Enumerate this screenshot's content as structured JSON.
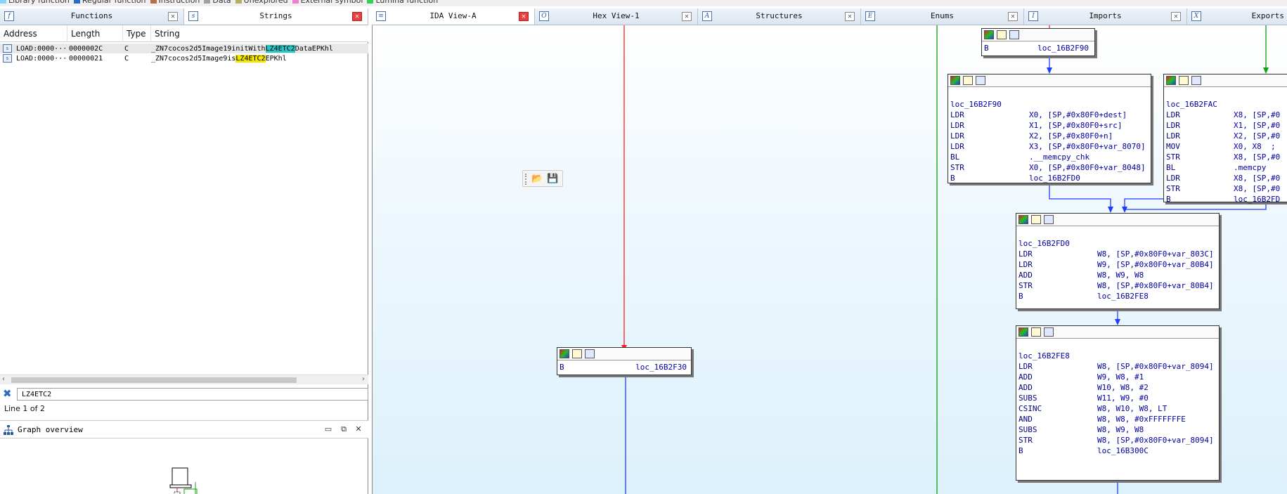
{
  "legend": {
    "items": [
      {
        "label": "Library function",
        "color": "#7fd6ff"
      },
      {
        "label": "Regular function",
        "color": "#1f6fd0"
      },
      {
        "label": "Instruction",
        "color": "#b86e4a"
      },
      {
        "label": "Data",
        "color": "#a0a0a0"
      },
      {
        "label": "Unexplored",
        "color": "#b0b060"
      },
      {
        "label": "External symbol",
        "color": "#f080d0"
      },
      {
        "label": "Lumina function",
        "color": "#30d050"
      }
    ]
  },
  "left_tabs": [
    {
      "label": "Functions",
      "icon": "function-icon",
      "glyph": "f",
      "active": false
    },
    {
      "label": "Strings",
      "icon": "strings-icon",
      "glyph": "s",
      "active": true
    }
  ],
  "main_tabs": [
    {
      "label": "IDA View-A",
      "icon": "ida-view-icon",
      "glyph": "≡",
      "active": true
    },
    {
      "label": "Hex View-1",
      "icon": "hex-view-icon",
      "glyph": "O",
      "active": false
    },
    {
      "label": "Structures",
      "icon": "structures-icon",
      "glyph": "A",
      "active": false
    },
    {
      "label": "Enums",
      "icon": "enums-icon",
      "glyph": "E",
      "active": false
    },
    {
      "label": "Imports",
      "icon": "imports-icon",
      "glyph": "I",
      "active": false
    },
    {
      "label": "Exports",
      "icon": "exports-icon",
      "glyph": "X",
      "active": false
    }
  ],
  "strings": {
    "columns": [
      "Address",
      "Length",
      "Type",
      "String"
    ],
    "rows": [
      {
        "address": "LOAD:0000···",
        "length": "0000002C",
        "type": "C",
        "pre": "_ZN7cocos2d5Image19initWith",
        "match": "LZ4ETC2",
        "post": "DataEPKhl",
        "hl": "cyan"
      },
      {
        "address": "LOAD:0000···",
        "length": "00000021",
        "type": "C",
        "pre": "_ZN7cocos2d5Image9is",
        "match": "LZ4ETC2",
        "post": "EPKhl",
        "hl": "yellow"
      }
    ],
    "search_value": "LZ4ETC2",
    "status": "Line 1 of 2"
  },
  "graph_overview": {
    "title": "Graph overview"
  },
  "graph": {
    "nodes": {
      "top_b": {
        "mnemonic": "B",
        "target": "loc_16B2F90"
      },
      "f90": {
        "label": "loc_16B2F90",
        "lines": [
          {
            "m": "LDR",
            "o": "X0, [SP,#0x80F0+dest]"
          },
          {
            "m": "LDR",
            "o": "X1, [SP,#0x80F0+src]"
          },
          {
            "m": "LDR",
            "o": "X2, [SP,#0x80F0+n]"
          },
          {
            "m": "LDR",
            "o": "X3, [SP,#0x80F0+var_8070]"
          },
          {
            "m": "BL",
            "o": ".__memcpy_chk"
          },
          {
            "m": "STR",
            "o": "X0, [SP,#0x80F0+var_8048]"
          },
          {
            "m": "B",
            "o": "loc_16B2FD0"
          }
        ]
      },
      "fac": {
        "label": "loc_16B2FAC",
        "lines": [
          {
            "m": "LDR",
            "o": "X8, [SP,#0"
          },
          {
            "m": "LDR",
            "o": "X1, [SP,#0"
          },
          {
            "m": "LDR",
            "o": "X2, [SP,#0"
          },
          {
            "m": "MOV",
            "o": "X0, X8  ;"
          },
          {
            "m": "STR",
            "o": "X8, [SP,#0"
          },
          {
            "m": "BL",
            "o": ".memcpy"
          },
          {
            "m": "LDR",
            "o": "X8, [SP,#0"
          },
          {
            "m": "STR",
            "o": "X8, [SP,#0"
          },
          {
            "m": "B",
            "o": "loc_16B2FD"
          }
        ]
      },
      "fd0": {
        "label": "loc_16B2FD0",
        "lines": [
          {
            "m": "LDR",
            "o": "W8, [SP,#0x80F0+var_803C]"
          },
          {
            "m": "LDR",
            "o": "W9, [SP,#0x80F0+var_80B4]"
          },
          {
            "m": "ADD",
            "o": "W8, W9, W8"
          },
          {
            "m": "STR",
            "o": "W8, [SP,#0x80F0+var_80B4]"
          },
          {
            "m": "B",
            "o": "loc_16B2FE8"
          }
        ]
      },
      "fe8": {
        "label": "loc_16B2FE8",
        "lines": [
          {
            "m": "LDR",
            "o": "W8, [SP,#0x80F0+var_8094]"
          },
          {
            "m": "ADD",
            "o": "W9, W8, #1"
          },
          {
            "m": "ADD",
            "o": "W10, W8, #2"
          },
          {
            "m": "SUBS",
            "o": "W11, W9, #0"
          },
          {
            "m": "CSINC",
            "o": "W8, W10, W8, LT"
          },
          {
            "m": "AND",
            "o": "W8, W8, #0xFFFFFFFE"
          },
          {
            "m": "SUBS",
            "o": "W8, W9, W8"
          },
          {
            "m": "STR",
            "o": "W8, [SP,#0x80F0+var_8094]"
          },
          {
            "m": "B",
            "o": "loc_16B300C"
          }
        ]
      },
      "mid_b": {
        "mnemonic": "B",
        "target": "loc_16B2F30"
      }
    },
    "colors": {
      "edge_red": "#ff2020",
      "edge_blue": "#1e3cff",
      "edge_green": "#10a010"
    }
  }
}
